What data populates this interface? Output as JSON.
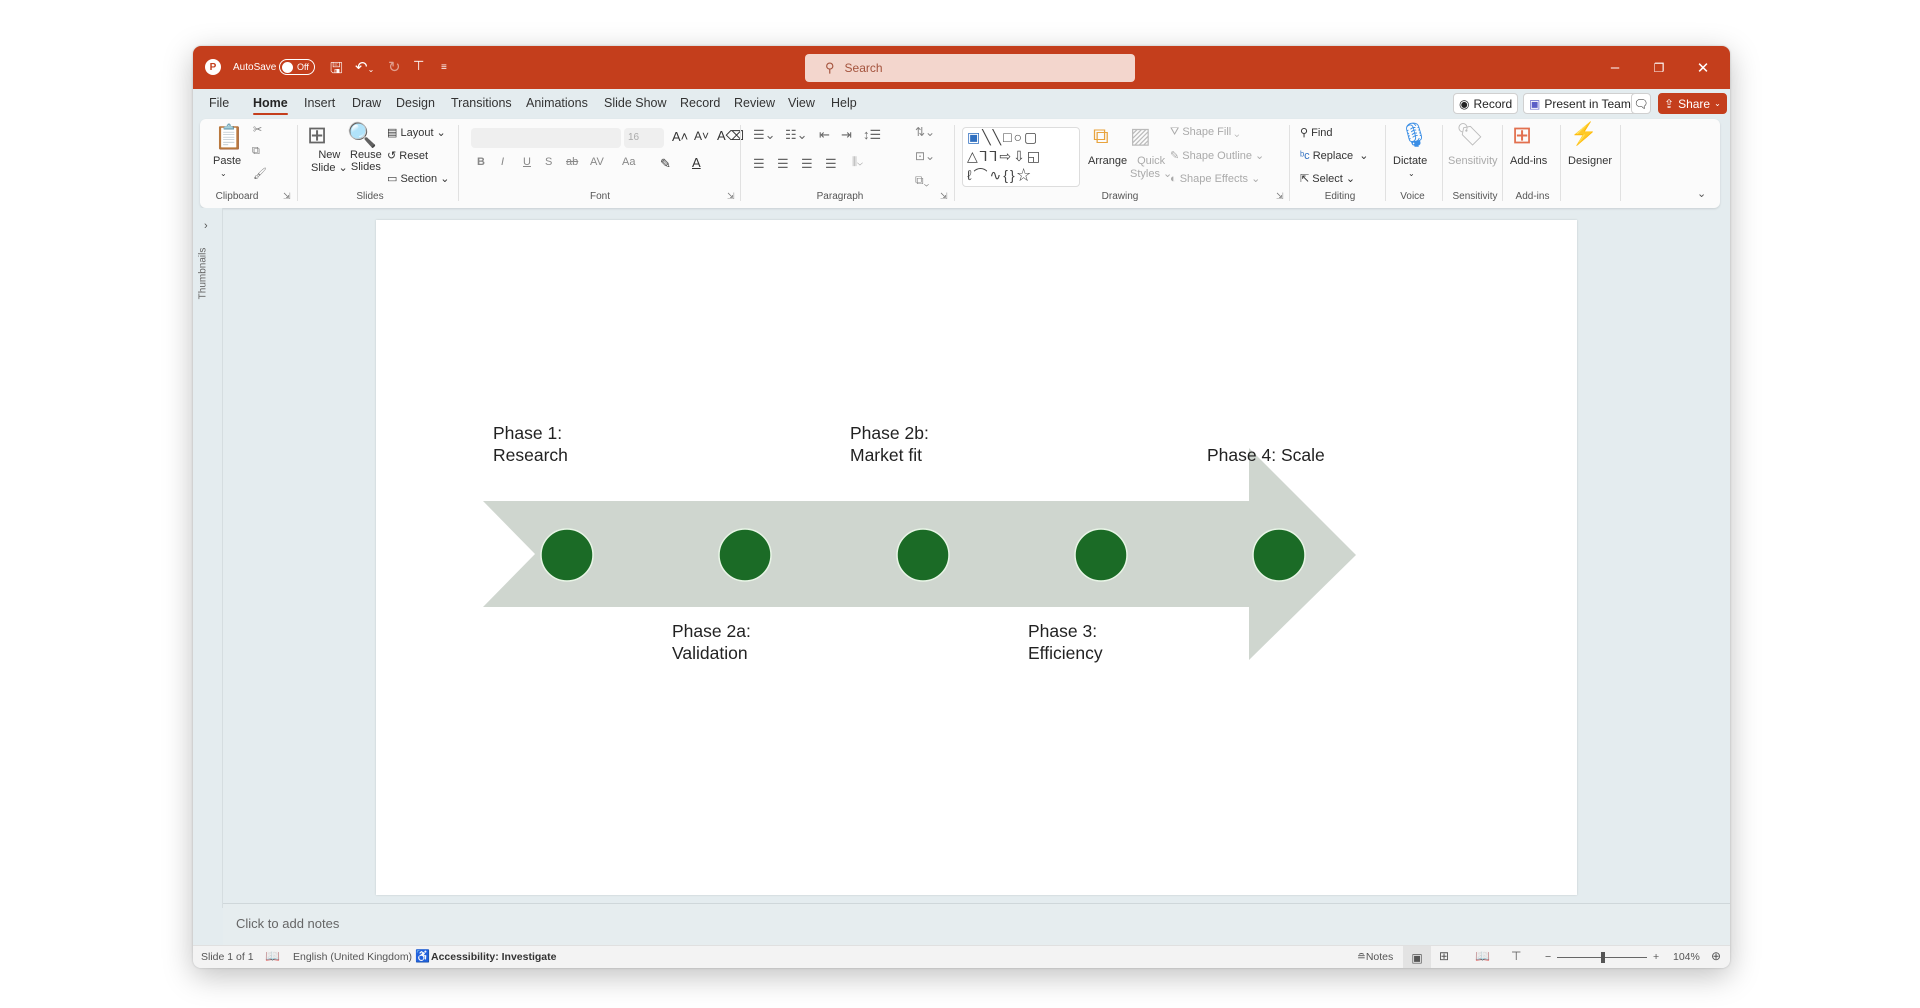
{
  "titlebar": {
    "autosave_label": "AutoSave",
    "autosave_state": "Off",
    "search_placeholder": "Search",
    "accent_color": "#c43e1c"
  },
  "tabs": [
    {
      "label": "File"
    },
    {
      "label": "Home",
      "active": true
    },
    {
      "label": "Insert"
    },
    {
      "label": "Draw"
    },
    {
      "label": "Design"
    },
    {
      "label": "Transitions"
    },
    {
      "label": "Animations"
    },
    {
      "label": "Slide Show"
    },
    {
      "label": "Record"
    },
    {
      "label": "Review"
    },
    {
      "label": "View"
    },
    {
      "label": "Help"
    }
  ],
  "tab_actions": {
    "record": "Record",
    "present_teams": "Present in Teams",
    "share": "Share"
  },
  "ribbon": {
    "clipboard": {
      "paste": "Paste",
      "label": "Clipboard"
    },
    "slides": {
      "new_slide_1": "New",
      "new_slide_2": "Slide",
      "reuse_1": "Reuse",
      "reuse_2": "Slides",
      "layout": "Layout",
      "reset": "Reset",
      "section": "Section",
      "label": "Slides"
    },
    "font": {
      "font_name": "",
      "font_size": "16",
      "bold": "B",
      "italic": "I",
      "underline": "U",
      "shadow": "S",
      "strike": "ab",
      "spacing": "AV",
      "case": "Aa",
      "label": "Font"
    },
    "paragraph": {
      "label": "Paragraph"
    },
    "drawing": {
      "arrange": "Arrange",
      "quick_styles_1": "Quick",
      "quick_styles_2": "Styles",
      "shape_fill": "Shape Fill",
      "shape_outline": "Shape Outline",
      "shape_effects": "Shape Effects",
      "label": "Drawing"
    },
    "editing": {
      "find": "Find",
      "replace": "Replace",
      "select": "Select",
      "label": "Editing"
    },
    "voice": {
      "dictate": "Dictate",
      "label": "Voice"
    },
    "sensitivity": {
      "button": "Sensitivity",
      "label": "Sensitivity"
    },
    "addins": {
      "button": "Add-ins",
      "label": "Add-ins"
    },
    "designer": {
      "button": "Designer"
    }
  },
  "left_pane": {
    "label": "Thumbnails"
  },
  "slide": {
    "arrow_color": "#cfd6cf",
    "dot_color": "#1b6b26",
    "phases": [
      {
        "line1": "Phase 1:",
        "line2": "Research",
        "position": "above"
      },
      {
        "line1": "Phase 2a:",
        "line2": "Validation",
        "position": "below"
      },
      {
        "line1": "Phase 2b:",
        "line2": "Market fit",
        "position": "above"
      },
      {
        "line1": "Phase 3:",
        "line2": "Efficiency",
        "position": "below"
      },
      {
        "line1": "Phase 4: Scale",
        "line2": "",
        "position": "above"
      }
    ]
  },
  "notes": {
    "placeholder": "Click to add notes"
  },
  "status": {
    "slide_count": "Slide 1 of 1",
    "language": "English (United Kingdom)",
    "accessibility": "Accessibility: Investigate",
    "notes_button": "Notes",
    "zoom_percent": "104%",
    "zoom_value": 104
  }
}
